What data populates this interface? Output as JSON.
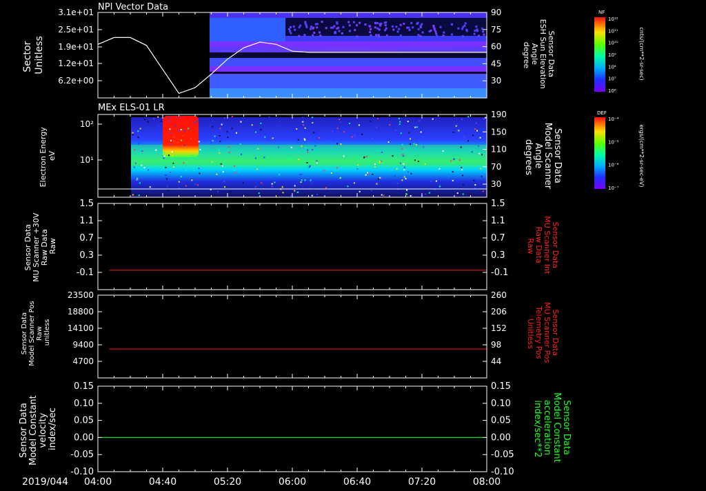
{
  "figure": {
    "date_label": "2019/044",
    "time_ticks": [
      "04:00",
      "04:40",
      "05:20",
      "06:00",
      "06:40",
      "07:20",
      "08:00"
    ]
  },
  "colors": {
    "background": "#000000",
    "axis": "#ffffff",
    "red_trace": "#cc1010",
    "green_trace": "#10dd10",
    "red_label": "#ff2020",
    "green_label": "#20ff20"
  },
  "chart_data": [
    {
      "type": "heatmap",
      "title": "NPI Vector Data",
      "ylabel": [
        "Sector",
        "Unitless"
      ],
      "y_ticks": [
        "3.1e+01",
        "2.5e+01",
        "1.9e+01",
        "1.2e+01",
        "6.2e+00"
      ],
      "y2label": [
        "Sensor Data",
        "ESH Sun Elevation",
        "Angle",
        "degree"
      ],
      "y2_ticks": [
        "90",
        "75",
        "60",
        "45",
        "30"
      ],
      "y2_values": [
        90,
        75,
        60,
        45,
        30
      ],
      "y2lim": [
        15,
        90
      ],
      "data_start": "05:07",
      "overlay_line": {
        "name": "ESH Sun Elevation Angle",
        "x": [
          "04:00",
          "04:10",
          "04:20",
          "04:30",
          "04:40",
          "04:50",
          "05:00",
          "05:10",
          "05:20",
          "05:30",
          "05:40",
          "05:50",
          "06:00",
          "06:10"
        ],
        "y": [
          62,
          68,
          68,
          61,
          40,
          19,
          24,
          36,
          49,
          59,
          64,
          62,
          56,
          55
        ]
      },
      "colorbar": {
        "label": "NF",
        "unit": "cnts/(cm**2-sr-sec)",
        "ticks": [
          "10¹²",
          "10¹¹",
          "10¹⁰",
          "10⁹",
          "10⁸",
          "10⁷",
          "10⁶"
        ]
      }
    },
    {
      "type": "heatmap",
      "title": "MEx ELS-01 LR",
      "ylabel": [
        "Electron Energy",
        "eV"
      ],
      "y_ticks": [
        "10²",
        "10¹"
      ],
      "y2label": [
        "Sensor Data",
        "Model Scanner",
        "Angle",
        "degrees"
      ],
      "y2_ticks": [
        "190",
        "150",
        "110",
        "70",
        "30"
      ],
      "y2_values": [
        190,
        150,
        110,
        70,
        30
      ],
      "y2lim": [
        0,
        190
      ],
      "data_start": "04:07",
      "burst": {
        "x": [
          "04:33",
          "04:50"
        ],
        "energy_range": "high"
      },
      "scanner_angle_line": {
        "value": 0
      },
      "colorbar": {
        "label": "DEF",
        "unit": "ergs/(cm**2-sr-sec-eV)",
        "ticks": [
          "10⁻⁴",
          "10⁻⁵",
          "10⁻⁶",
          "10⁻⁷"
        ]
      }
    },
    {
      "type": "line",
      "ylabel": [
        "Sensor Data",
        "MU Scanner +30V",
        "Raw Data",
        "Raw"
      ],
      "y_ticks": [
        "1.5",
        "1.1",
        "0.7",
        "0.3",
        "-0.1"
      ],
      "y_values": [
        1.5,
        1.1,
        0.7,
        0.3,
        -0.1
      ],
      "ylim": [
        -0.5,
        1.5
      ],
      "y2label": [
        "Sensor Data",
        "MU Scanner Int",
        "Raw Data",
        "Raw"
      ],
      "y2_ticks": [
        "1.5",
        "1.1",
        "0.7",
        "0.3",
        "-0.1"
      ],
      "series": [
        {
          "name": "MU Scanner Int Raw Data",
          "x": [
            "04:07",
            "08:00"
          ],
          "y": [
            -0.05,
            -0.05
          ]
        }
      ]
    },
    {
      "type": "line",
      "ylabel": [
        "Sensor Data",
        "Model Scanner Pos",
        "Raw",
        "unitless"
      ],
      "y_ticks": [
        "23500",
        "18800",
        "14100",
        "9400",
        "4700"
      ],
      "y_values": [
        23500,
        18800,
        14100,
        9400,
        4700
      ],
      "ylim": [
        0,
        23500
      ],
      "y2label": [
        "Sensor Data",
        "MU Scanner Pos",
        "Telemetry Pos",
        "Unitless"
      ],
      "y2_ticks": [
        "260",
        "206",
        "152",
        "98",
        "44"
      ],
      "y2_values": [
        260,
        206,
        152,
        98,
        44
      ],
      "y2lim": [
        -10,
        260
      ],
      "series": [
        {
          "name": "MU Scanner Pos Telemetry Pos",
          "x": [
            "04:07",
            "08:00"
          ],
          "y": [
            8200,
            8200
          ]
        }
      ]
    },
    {
      "type": "line",
      "ylabel": [
        "Sensor Data",
        "Model Constant",
        "velocity",
        "index/sec"
      ],
      "y_ticks": [
        "0.15",
        "0.10",
        "0.05",
        "0.00",
        "-0.05",
        "-0.10"
      ],
      "y_values": [
        0.15,
        0.1,
        0.05,
        0.0,
        -0.05,
        -0.1
      ],
      "ylim": [
        -0.1,
        0.15
      ],
      "y2label": [
        "Sensor Data",
        "Model Constant",
        "acceleration",
        "index/sec**2"
      ],
      "y2_ticks": [
        "0.15",
        "0.10",
        "0.05",
        "0.00",
        "-0.05",
        "-0.10"
      ],
      "series": [
        {
          "name": "Model Constant acceleration",
          "x": [
            "04:00",
            "08:00"
          ],
          "y": [
            0.0,
            0.0
          ]
        }
      ]
    }
  ]
}
